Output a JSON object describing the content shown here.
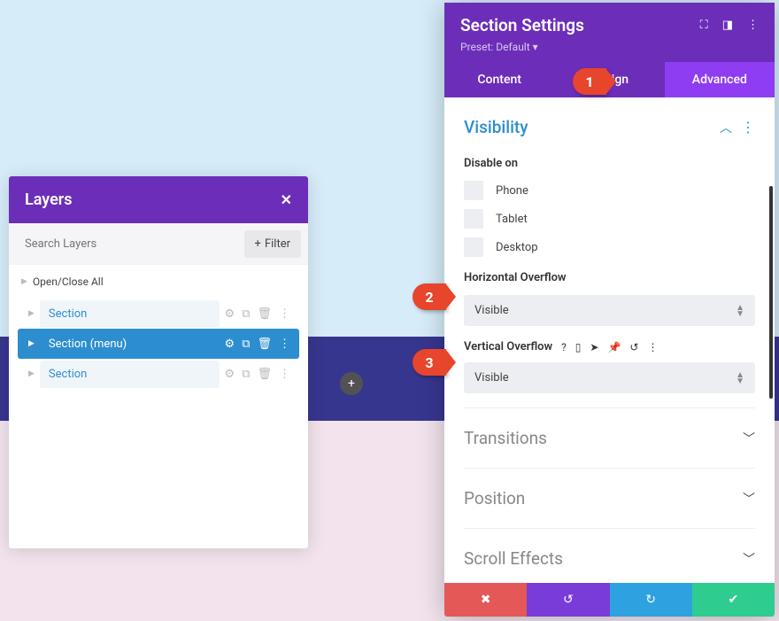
{
  "layers": {
    "title": "Layers",
    "search_placeholder": "Search Layers",
    "filter_label": "Filter",
    "open_close_label": "Open/Close All",
    "items": [
      {
        "label": "Section",
        "selected": false
      },
      {
        "label": "Section (menu)",
        "selected": true
      },
      {
        "label": "Section",
        "selected": false
      }
    ]
  },
  "settings": {
    "title": "Section Settings",
    "preset_label": "Preset: Default",
    "tabs": {
      "content": "Content",
      "design": "Design",
      "advanced": "Advanced"
    },
    "visibility": {
      "title": "Visibility",
      "disable_on_label": "Disable on",
      "disable_options": {
        "phone": "Phone",
        "tablet": "Tablet",
        "desktop": "Desktop"
      },
      "horizontal_label": "Horizontal Overflow",
      "horizontal_value": "Visible",
      "vertical_label": "Vertical Overflow",
      "vertical_value": "Visible"
    },
    "transitions_title": "Transitions",
    "position_title": "Position",
    "scroll_title": "Scroll Effects"
  },
  "callouts": {
    "one": "1",
    "two": "2",
    "three": "3"
  }
}
